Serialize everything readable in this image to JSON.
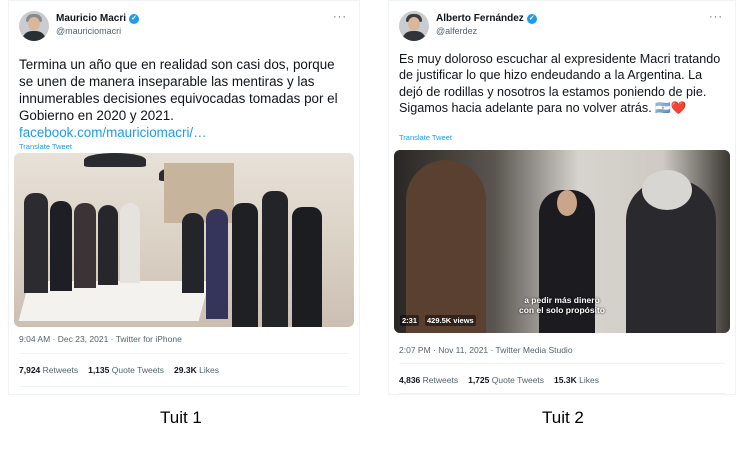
{
  "tweets": [
    {
      "name": "Mauricio Macri",
      "handle": "@mauriciomacri",
      "more": "···",
      "verified_icon": "✓",
      "text": "Termina un año que en realidad son casi dos, porque se unen de manera inseparable las mentiras y las innumerables decisiones equivocadas tomadas por el Gobierno en 2020 y 2021.",
      "link": "facebook.com/mauriciomacri/…",
      "translate": "Translate Tweet",
      "timestamp": "9:04 AM · Dec 23, 2021 · Twitter for iPhone",
      "stats": {
        "retweets_count": "7,924",
        "retweets_label": "Retweets",
        "quotes_count": "1,135",
        "quotes_label": "Quote Tweets",
        "likes_count": "29.3K",
        "likes_label": "Likes"
      },
      "media": {
        "type": "photo",
        "description_icon": "group-photo"
      }
    },
    {
      "name": "Alberto Fernández",
      "handle": "@alferdez",
      "more": "···",
      "verified_icon": "✓",
      "text": "Es muy doloroso escuchar al expresidente Macri tratando de justificar lo que hizo endeudando a la Argentina. La dejó de rodillas y nosotros la estamos poniendo de pie. Sigamos hacia adelante para no volver atrás. 🇦🇷❤️",
      "translate": "Translate Tweet",
      "timestamp": "2:07 PM · Nov 11, 2021 · Twitter Media Studio",
      "stats": {
        "retweets_count": "4,836",
        "retweets_label": "Retweets",
        "quotes_count": "1,725",
        "quotes_label": "Quote Tweets",
        "likes_count": "15.3K",
        "likes_label": "Likes"
      },
      "media": {
        "type": "video",
        "caption_line1": "a pedir más dinero",
        "caption_line2": "con el solo propósito",
        "duration": "2:31",
        "views": "429.5K views"
      }
    }
  ],
  "captions": [
    "Tuit 1",
    "Tuit 2"
  ],
  "colors": {
    "link": "#1d9bf0",
    "verified": "#1d9bf0",
    "muted": "#536471",
    "text": "#0f1419"
  }
}
